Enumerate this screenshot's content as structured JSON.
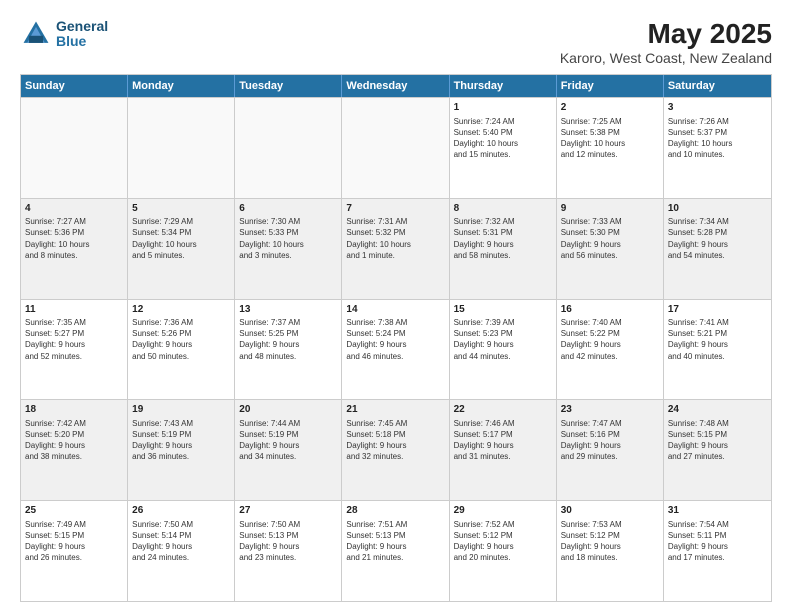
{
  "logo": {
    "line1": "General",
    "line2": "Blue"
  },
  "title": "May 2025",
  "subtitle": "Karoro, West Coast, New Zealand",
  "header_days": [
    "Sunday",
    "Monday",
    "Tuesday",
    "Wednesday",
    "Thursday",
    "Friday",
    "Saturday"
  ],
  "rows": [
    [
      {
        "day": "",
        "text": "",
        "empty": true
      },
      {
        "day": "",
        "text": "",
        "empty": true
      },
      {
        "day": "",
        "text": "",
        "empty": true
      },
      {
        "day": "",
        "text": "",
        "empty": true
      },
      {
        "day": "1",
        "text": "Sunrise: 7:24 AM\nSunset: 5:40 PM\nDaylight: 10 hours\nand 15 minutes."
      },
      {
        "day": "2",
        "text": "Sunrise: 7:25 AM\nSunset: 5:38 PM\nDaylight: 10 hours\nand 12 minutes."
      },
      {
        "day": "3",
        "text": "Sunrise: 7:26 AM\nSunset: 5:37 PM\nDaylight: 10 hours\nand 10 minutes."
      }
    ],
    [
      {
        "day": "4",
        "text": "Sunrise: 7:27 AM\nSunset: 5:36 PM\nDaylight: 10 hours\nand 8 minutes."
      },
      {
        "day": "5",
        "text": "Sunrise: 7:29 AM\nSunset: 5:34 PM\nDaylight: 10 hours\nand 5 minutes."
      },
      {
        "day": "6",
        "text": "Sunrise: 7:30 AM\nSunset: 5:33 PM\nDaylight: 10 hours\nand 3 minutes."
      },
      {
        "day": "7",
        "text": "Sunrise: 7:31 AM\nSunset: 5:32 PM\nDaylight: 10 hours\nand 1 minute."
      },
      {
        "day": "8",
        "text": "Sunrise: 7:32 AM\nSunset: 5:31 PM\nDaylight: 9 hours\nand 58 minutes."
      },
      {
        "day": "9",
        "text": "Sunrise: 7:33 AM\nSunset: 5:30 PM\nDaylight: 9 hours\nand 56 minutes."
      },
      {
        "day": "10",
        "text": "Sunrise: 7:34 AM\nSunset: 5:28 PM\nDaylight: 9 hours\nand 54 minutes."
      }
    ],
    [
      {
        "day": "11",
        "text": "Sunrise: 7:35 AM\nSunset: 5:27 PM\nDaylight: 9 hours\nand 52 minutes."
      },
      {
        "day": "12",
        "text": "Sunrise: 7:36 AM\nSunset: 5:26 PM\nDaylight: 9 hours\nand 50 minutes."
      },
      {
        "day": "13",
        "text": "Sunrise: 7:37 AM\nSunset: 5:25 PM\nDaylight: 9 hours\nand 48 minutes."
      },
      {
        "day": "14",
        "text": "Sunrise: 7:38 AM\nSunset: 5:24 PM\nDaylight: 9 hours\nand 46 minutes."
      },
      {
        "day": "15",
        "text": "Sunrise: 7:39 AM\nSunset: 5:23 PM\nDaylight: 9 hours\nand 44 minutes."
      },
      {
        "day": "16",
        "text": "Sunrise: 7:40 AM\nSunset: 5:22 PM\nDaylight: 9 hours\nand 42 minutes."
      },
      {
        "day": "17",
        "text": "Sunrise: 7:41 AM\nSunset: 5:21 PM\nDaylight: 9 hours\nand 40 minutes."
      }
    ],
    [
      {
        "day": "18",
        "text": "Sunrise: 7:42 AM\nSunset: 5:20 PM\nDaylight: 9 hours\nand 38 minutes."
      },
      {
        "day": "19",
        "text": "Sunrise: 7:43 AM\nSunset: 5:19 PM\nDaylight: 9 hours\nand 36 minutes."
      },
      {
        "day": "20",
        "text": "Sunrise: 7:44 AM\nSunset: 5:19 PM\nDaylight: 9 hours\nand 34 minutes."
      },
      {
        "day": "21",
        "text": "Sunrise: 7:45 AM\nSunset: 5:18 PM\nDaylight: 9 hours\nand 32 minutes."
      },
      {
        "day": "22",
        "text": "Sunrise: 7:46 AM\nSunset: 5:17 PM\nDaylight: 9 hours\nand 31 minutes."
      },
      {
        "day": "23",
        "text": "Sunrise: 7:47 AM\nSunset: 5:16 PM\nDaylight: 9 hours\nand 29 minutes."
      },
      {
        "day": "24",
        "text": "Sunrise: 7:48 AM\nSunset: 5:15 PM\nDaylight: 9 hours\nand 27 minutes."
      }
    ],
    [
      {
        "day": "25",
        "text": "Sunrise: 7:49 AM\nSunset: 5:15 PM\nDaylight: 9 hours\nand 26 minutes."
      },
      {
        "day": "26",
        "text": "Sunrise: 7:50 AM\nSunset: 5:14 PM\nDaylight: 9 hours\nand 24 minutes."
      },
      {
        "day": "27",
        "text": "Sunrise: 7:50 AM\nSunset: 5:13 PM\nDaylight: 9 hours\nand 23 minutes."
      },
      {
        "day": "28",
        "text": "Sunrise: 7:51 AM\nSunset: 5:13 PM\nDaylight: 9 hours\nand 21 minutes."
      },
      {
        "day": "29",
        "text": "Sunrise: 7:52 AM\nSunset: 5:12 PM\nDaylight: 9 hours\nand 20 minutes."
      },
      {
        "day": "30",
        "text": "Sunrise: 7:53 AM\nSunset: 5:12 PM\nDaylight: 9 hours\nand 18 minutes."
      },
      {
        "day": "31",
        "text": "Sunrise: 7:54 AM\nSunset: 5:11 PM\nDaylight: 9 hours\nand 17 minutes."
      }
    ]
  ]
}
